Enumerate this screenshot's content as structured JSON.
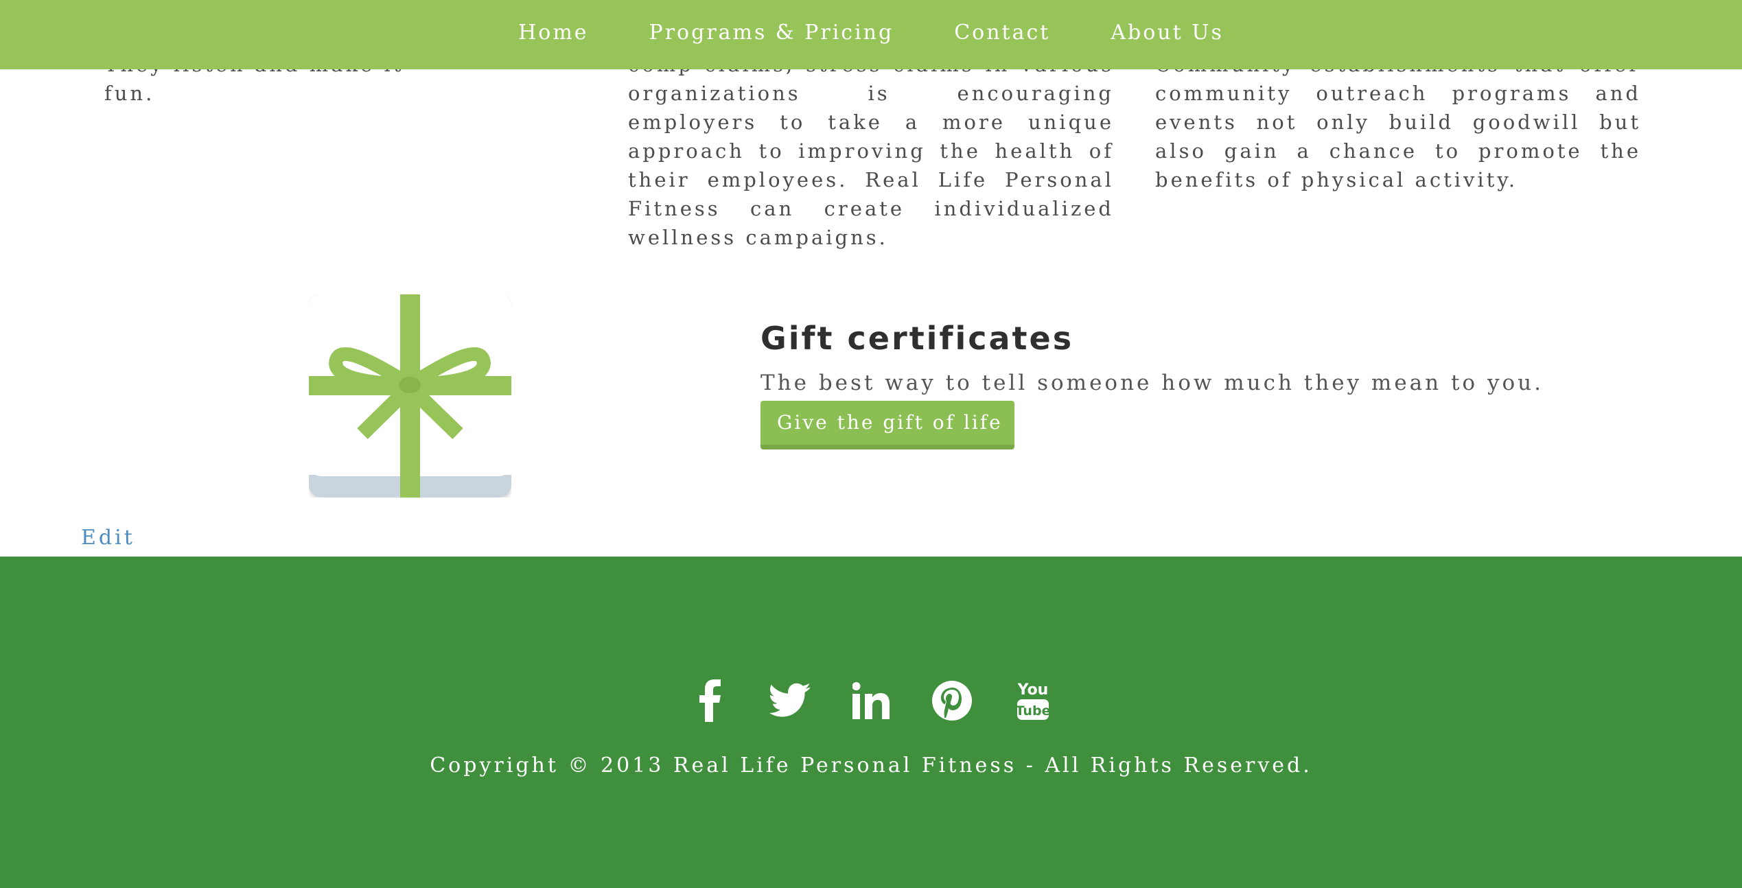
{
  "nav": {
    "items": [
      {
        "label": "Home"
      },
      {
        "label": "Programs & Pricing"
      },
      {
        "label": "Contact"
      },
      {
        "label": "About Us"
      }
    ]
  },
  "columns": {
    "left": "They listen and make it fun.",
    "middle": "comp claims, stress claims in various organizations is encouraging employers to take a more unique approach to improving the health of their employees. Real Life Personal Fitness can create individualized wellness campaigns.",
    "right": "Community establishments that offer community outreach programs and events not only build goodwill but also gain a chance to promote the benefits of physical activity."
  },
  "gift": {
    "icon": "gift-box-icon",
    "title": "Gift certificates",
    "subtitle": "The best way to tell someone how much they mean to you.",
    "button_label": "Give the gift of life"
  },
  "edit_label": "Edit",
  "footer": {
    "social_icons": [
      "facebook-icon",
      "twitter-icon",
      "linkedin-icon",
      "pinterest-icon",
      "youtube-icon"
    ],
    "copyright": "Copyright © 2013 Real Life Personal Fitness - All Rights Reserved."
  },
  "colors": {
    "nav_bg": "#97c459",
    "button_bg": "#8cbf53",
    "footer_bg": "#3f8f3d",
    "link": "#4d8bbd"
  }
}
